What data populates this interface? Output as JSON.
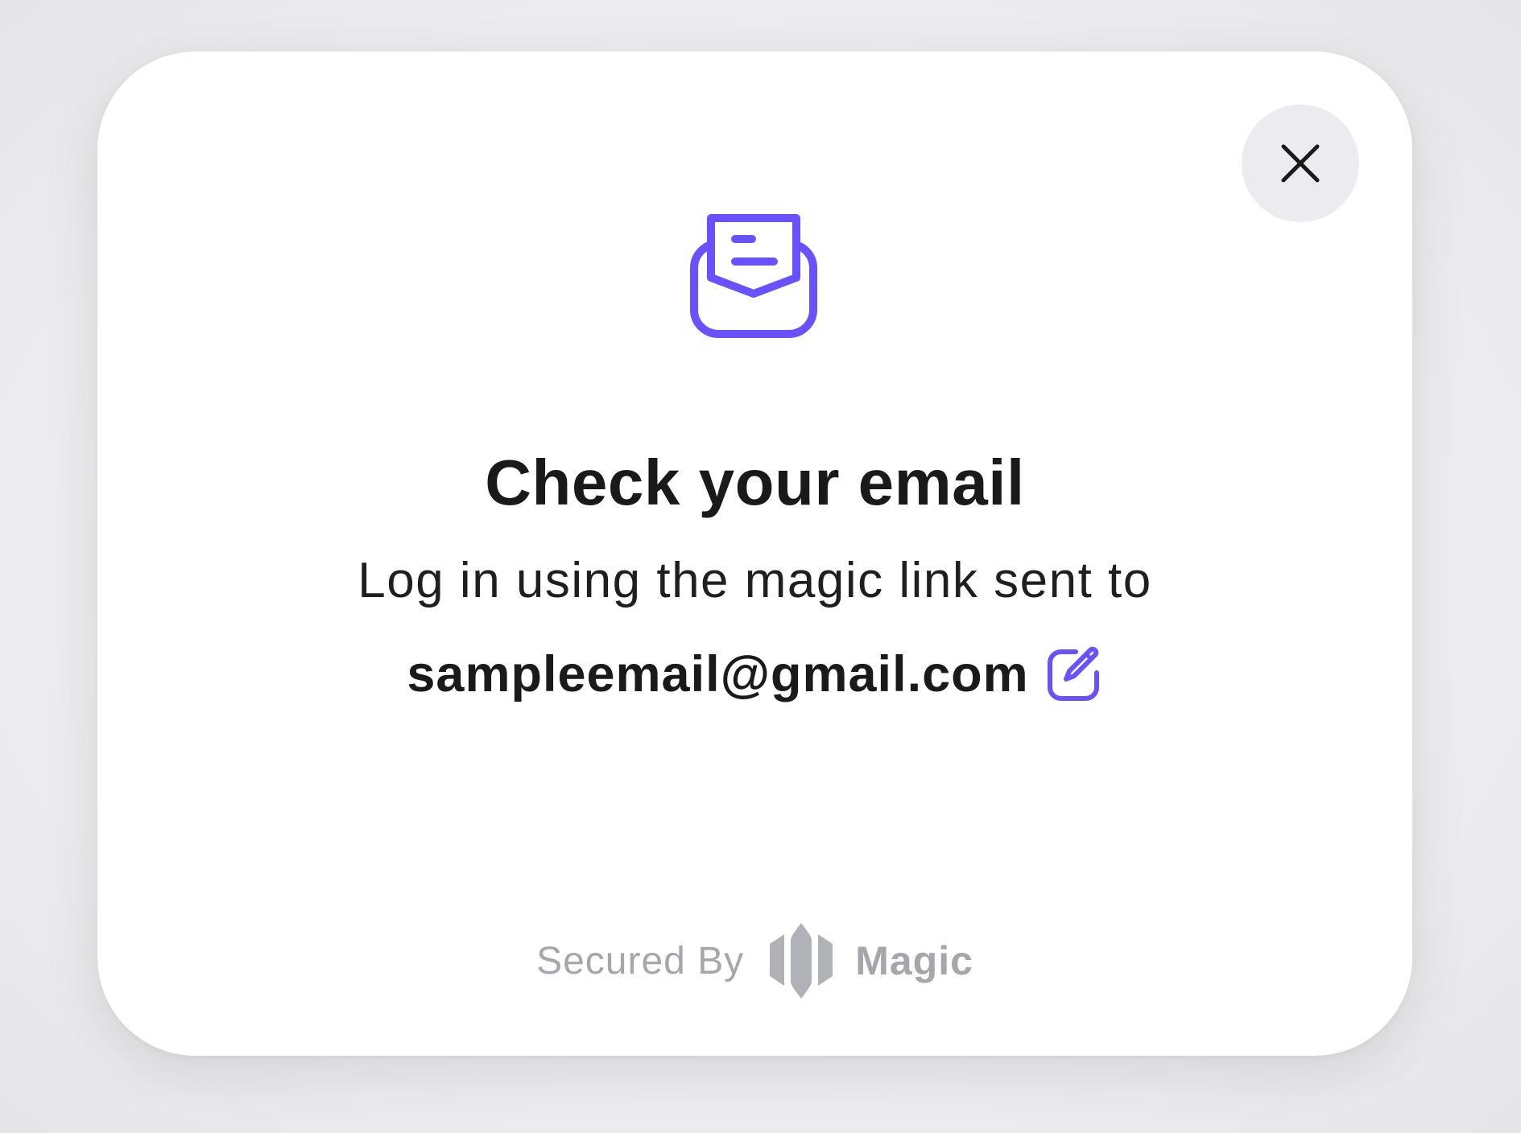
{
  "dialog": {
    "title": "Check your email",
    "subtitle": "Log in using the magic link sent to",
    "email": "sampleemail@gmail.com",
    "close_icon": "close-icon",
    "mail_icon": "mail-open-icon",
    "edit_icon": "edit-icon"
  },
  "footer": {
    "secured_label": "Secured By",
    "brand_name": "Magic",
    "brand_logo": "magic-logo"
  },
  "colors": {
    "accent": "#6851ff",
    "text": "#1a1a1a",
    "muted": "#a6a6ad",
    "close_bg": "#ececf0"
  }
}
